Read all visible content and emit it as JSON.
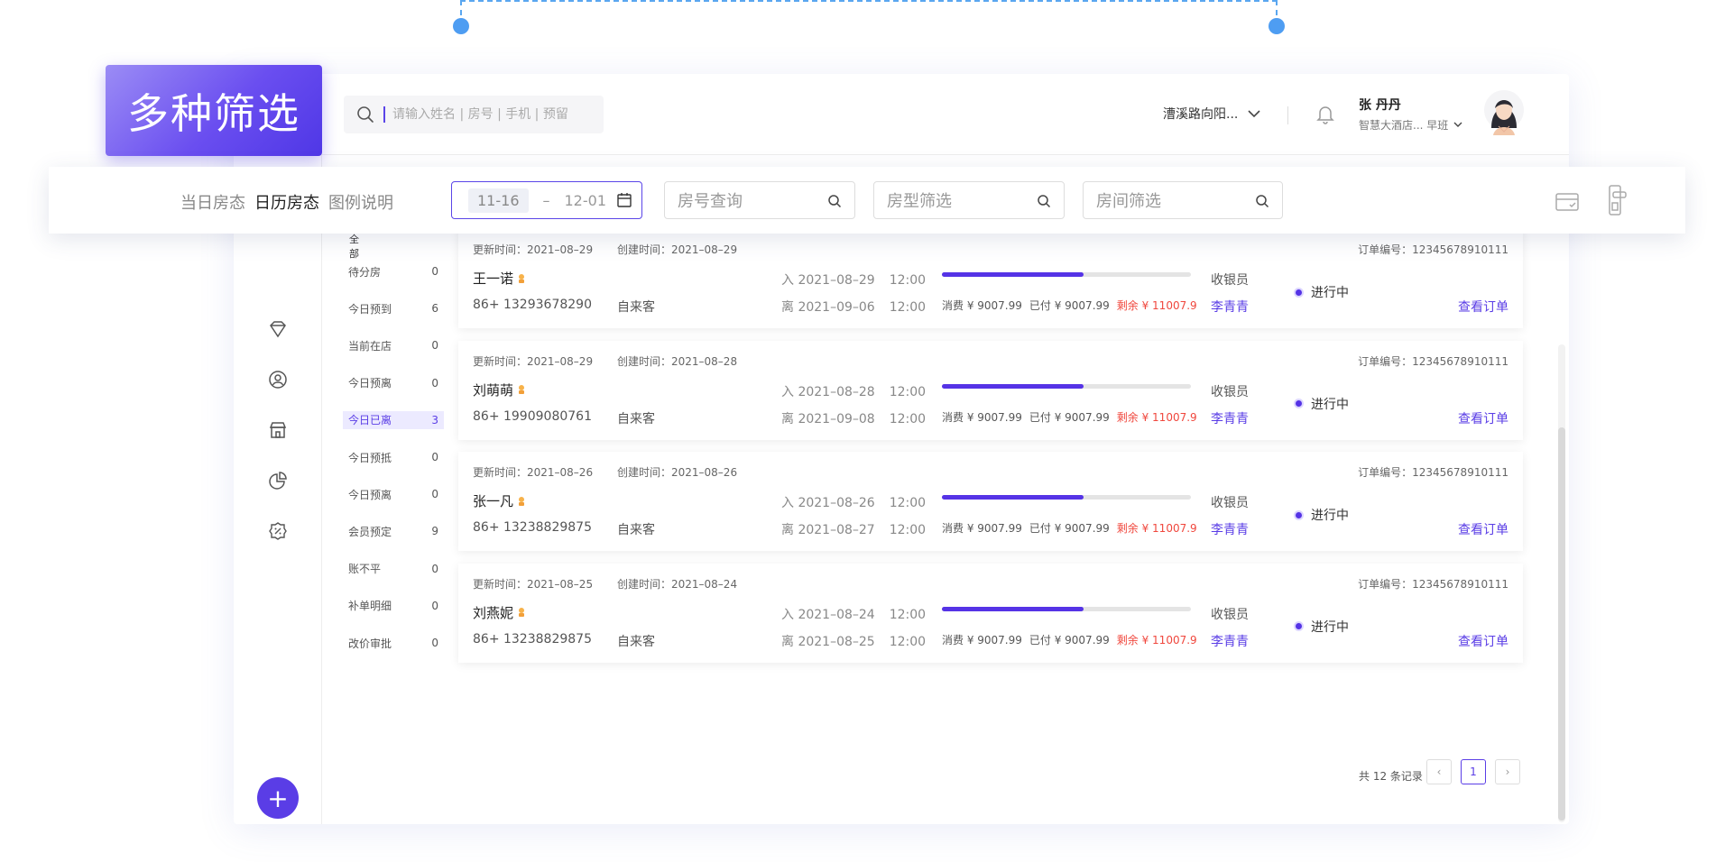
{
  "feature_badge": "多种筛选",
  "header": {
    "search_placeholder": "请输入姓名 | 房号 | 手机 | 预留",
    "store_name": "漕溪路向阳...",
    "user_name": "张 丹丹",
    "user_subtitle": "智慧大酒店... 早班"
  },
  "filters": {
    "tabs": [
      "当日房态",
      "日历房态",
      "图例说明"
    ],
    "date_start": "11-16",
    "date_sep": "–",
    "date_end": "12-01",
    "room_no_placeholder": "房号查询",
    "room_type_placeholder": "房型筛选",
    "room_placeholder": "房间筛选"
  },
  "categories": {
    "all_label": "全部",
    "items": [
      {
        "label": "待分房",
        "count": "0"
      },
      {
        "label": "今日预到",
        "count": "6"
      },
      {
        "label": "当前在店",
        "count": "0"
      },
      {
        "label": "今日预离",
        "count": "0"
      },
      {
        "label": "今日已离",
        "count": "3"
      },
      {
        "label": "今日预抵",
        "count": "0"
      },
      {
        "label": "今日预离",
        "count": "0"
      },
      {
        "label": "会员预定",
        "count": "9"
      },
      {
        "label": "账不平",
        "count": "0"
      },
      {
        "label": "补单明细",
        "count": "0"
      },
      {
        "label": "改价审批",
        "count": "0"
      }
    ]
  },
  "orders": [
    {
      "updated": "更新时间：2021–08–29",
      "created": "创建时间：2021–08–29",
      "order_no": "订单编号：12345678910111",
      "name": "王一诺",
      "phone": "86+ 13293678290",
      "source": "自来客",
      "in_date": "入 2021–08–29",
      "in_time": "12:00",
      "out_date": "离 2021–09–06",
      "out_time": "12:00",
      "progress": 0.57,
      "consume": "消费 ¥ 9007.99",
      "paid": "已付 ¥ 9007.99",
      "remain": "剩余 ¥ 11007.9",
      "cashier_label": "收银员",
      "cashier": "李青青",
      "status": "进行中",
      "action": "查看订单"
    },
    {
      "updated": "更新时间：2021–08–29",
      "created": "创建时间：2021–08–28",
      "order_no": "订单编号：12345678910111",
      "name": "刘萌萌",
      "phone": "86+ 19909080761",
      "source": "自来客",
      "in_date": "入 2021–08–28",
      "in_time": "12:00",
      "out_date": "离 2021–09–08",
      "out_time": "12:00",
      "progress": 0.57,
      "consume": "消费 ¥ 9007.99",
      "paid": "已付 ¥ 9007.99",
      "remain": "剩余 ¥ 11007.9",
      "cashier_label": "收银员",
      "cashier": "李青青",
      "status": "进行中",
      "action": "查看订单"
    },
    {
      "updated": "更新时间：2021–08–26",
      "created": "创建时间：2021–08–26",
      "order_no": "订单编号：12345678910111",
      "name": "张一凡",
      "phone": "86+ 13238829875",
      "source": "自来客",
      "in_date": "入 2021–08–26",
      "in_time": "12:00",
      "out_date": "离 2021–08–27",
      "out_time": "12:00",
      "progress": 0.57,
      "consume": "消费 ¥ 9007.99",
      "paid": "已付 ¥ 9007.99",
      "remain": "剩余 ¥ 11007.9",
      "cashier_label": "收银员",
      "cashier": "李青青",
      "status": "进行中",
      "action": "查看订单"
    },
    {
      "updated": "更新时间：2021–08–25",
      "created": "创建时间：2021–08–24",
      "order_no": "订单编号：12345678910111",
      "name": "刘燕妮",
      "phone": "86+ 13238829875",
      "source": "自来客",
      "in_date": "入 2021–08–24",
      "in_time": "12:00",
      "out_date": "离 2021–08–25",
      "out_time": "12:00",
      "progress": 0.57,
      "consume": "消费 ¥ 9007.99",
      "paid": "已付 ¥ 9007.99",
      "remain": "剩余 ¥ 11007.9",
      "cashier_label": "收银员",
      "cashier": "李青青",
      "status": "进行中",
      "action": "查看订单"
    }
  ],
  "pagination": {
    "total": "共 12 条记录",
    "current": "1",
    "prev": "‹",
    "next": "›"
  },
  "icons": {
    "rail": [
      "diamond-icon",
      "user-circle-icon",
      "store-icon",
      "pie-chart-icon",
      "discount-badge-icon"
    ],
    "add": "+"
  },
  "colors": {
    "accent": "#5533e6",
    "remain": "#f0473d",
    "guide": "#4e9df2"
  }
}
